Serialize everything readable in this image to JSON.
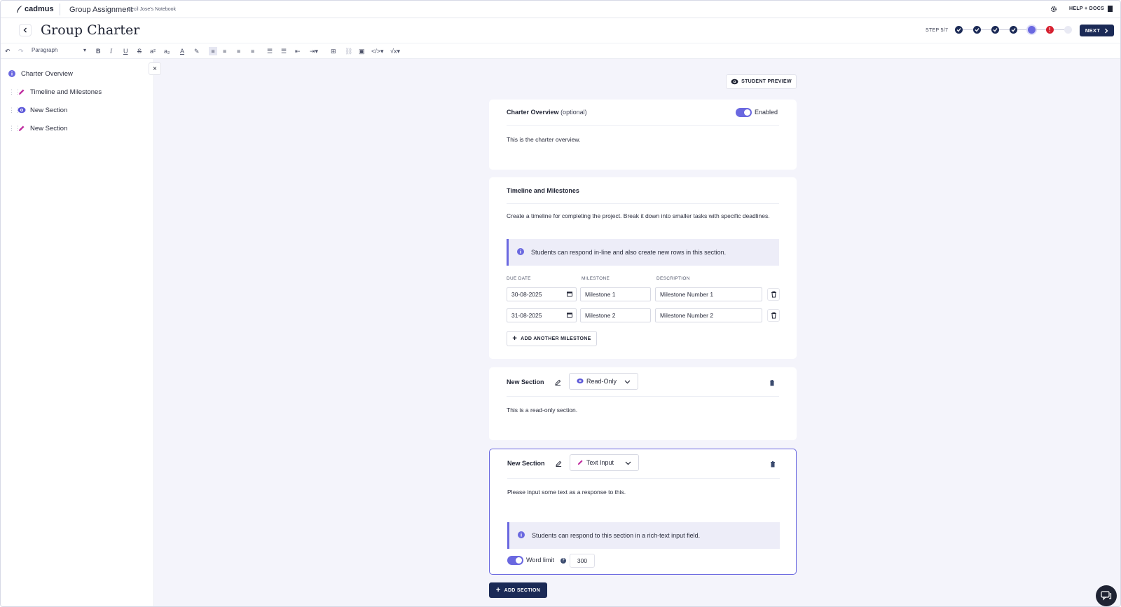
{
  "app": {
    "logo": "cadmus"
  },
  "topbar": {
    "breadcrumb": "Group Assignment",
    "notebook": "Cecil Jose's Notebook",
    "help_label": "HELP + DOCS"
  },
  "header": {
    "title": "Group Charter",
    "step_label": "STEP 5/7",
    "next_label": "NEXT",
    "steps": [
      "done",
      "done",
      "done",
      "done",
      "current",
      "error",
      "todo"
    ]
  },
  "toolbar": {
    "format": "Paragraph"
  },
  "sidebar": {
    "items": [
      {
        "label": "Charter Overview",
        "icon": "info-icon"
      },
      {
        "label": "Timeline and Milestones",
        "icon": "pencil-icon"
      },
      {
        "label": "New Section",
        "icon": "eye-icon"
      },
      {
        "label": "New Section",
        "icon": "pencil-icon"
      }
    ]
  },
  "preview_label": "STUDENT PREVIEW",
  "overview": {
    "title": "Charter Overview",
    "optional": "(optional)",
    "toggle_label": "Enabled",
    "text": "This is the charter overview."
  },
  "timeline": {
    "title": "Timeline and Milestones",
    "text": "Create a timeline for completing the project. Break it down into smaller tasks with specific deadlines.",
    "info": "Students can respond in-line and also create new rows in this section.",
    "headers": {
      "date": "DUE DATE",
      "milestone": "MILESTONE",
      "description": "DESCRIPTION"
    },
    "rows": [
      {
        "date": "30-08-2025",
        "milestone": "Milestone 1",
        "description": "Milestone Number 1"
      },
      {
        "date": "31-08-2025",
        "milestone": "Milestone 2",
        "description": "Milestone Number 2"
      }
    ],
    "add_label": "ADD ANOTHER MILESTONE"
  },
  "section_readonly": {
    "title": "New Section",
    "mode": "Read-Only",
    "text": "This is a read-only section."
  },
  "section_text": {
    "title": "New Section",
    "mode": "Text Input",
    "text": "Please input some text as a response to this.",
    "info": "Students can respond to this section in a rich-text input field.",
    "word_limit_label": "Word limit",
    "word_limit": "300"
  },
  "add_section_label": "ADD SECTION",
  "colors": {
    "accent": "#6a68e0",
    "navy": "#1b2a56",
    "background": "#f4f4fb"
  }
}
